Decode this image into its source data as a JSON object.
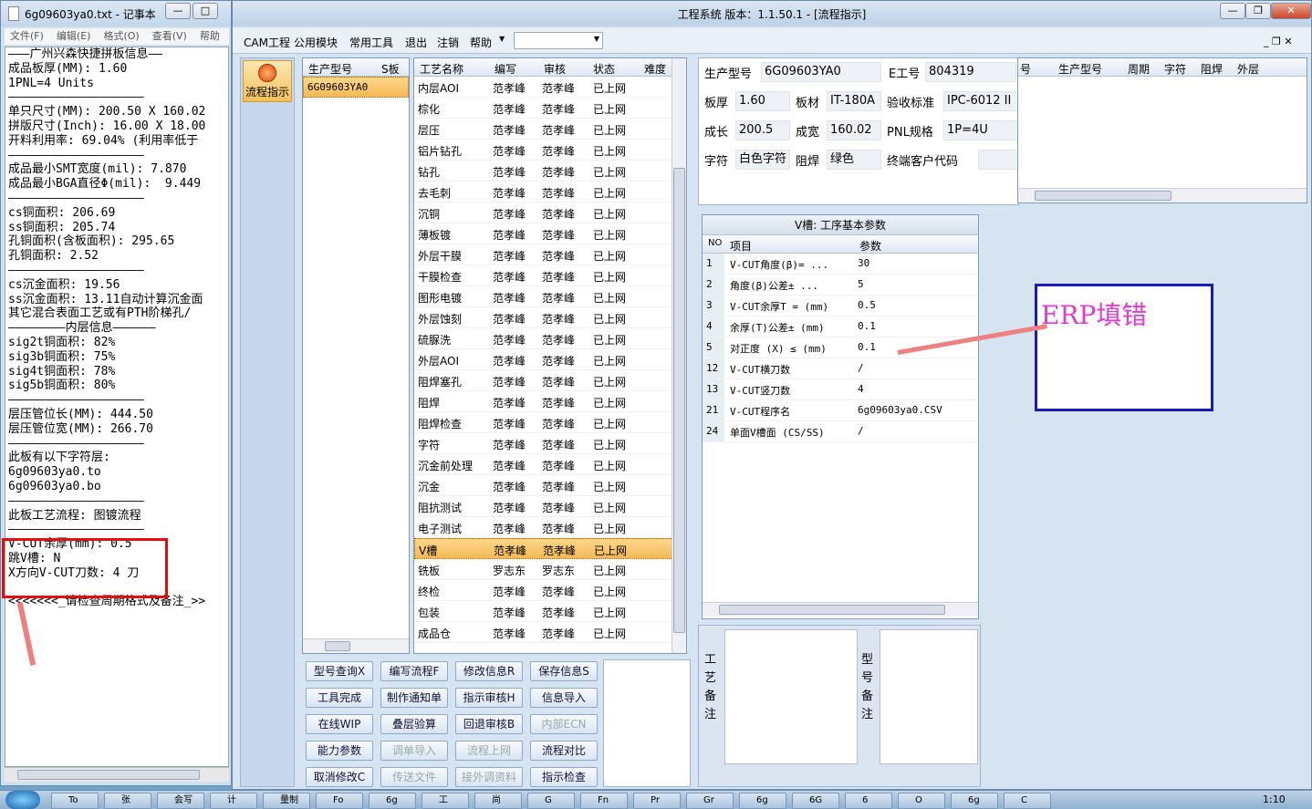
{
  "notepad": {
    "title": "6g09603ya0.txt - 记事本",
    "menu": [
      "文件(F)",
      "编辑(E)",
      "格式(O)",
      "查看(V)",
      "帮助"
    ],
    "lines": [
      "———广州兴森快捷拼板信息——",
      "成品板厚(MM): 1.60",
      "1PNL=4 Units",
      "———————————————————",
      "单只尺寸(MM): 200.50 X 160.02",
      "拼版尺寸(Inch): 16.00 X 18.00",
      "开料利用率: 69.04% (利用率低于",
      "———————————————————",
      "成品最小SMT宽度(mil): 7.870",
      "成品最小BGA直径Φ(mil):  9.449",
      "———————————————————",
      "cs铜面积: 206.69",
      "ss铜面积: 205.74",
      "孔铜面积(含板面积): 295.65",
      "孔铜面积: 2.52",
      "———————————————————",
      "cs沉金面积: 19.56",
      "ss沉金面积: 13.11自动计算沉金面",
      "其它混合表面工艺或有PTH阶梯孔/",
      "————————内层信息——————",
      "sig2t铜面积: 82%",
      "sig3b铜面积: 75%",
      "sig4t铜面积: 78%",
      "sig5b铜面积: 80%",
      "———————————————————",
      "层压管位长(MM): 444.50",
      "层压管位宽(MM): 266.70",
      "———————————————————",
      "此板有以下字符层:",
      "6g09603ya0.to",
      "6g09603ya0.bo",
      "———————————————————",
      "此板工艺流程: 图镀流程",
      "———————————————————",
      "V-CUT余厚(mm): 0.5",
      "跳V槽: N",
      "X方向V-CUT刀数: 4 刀",
      "",
      "<<<<<<<_请检查周期格式及备注_>>"
    ]
  },
  "app": {
    "title": "工程系统   版本：1.1.50.1 - [流程指示]",
    "menu": [
      "CAM工程",
      "公用模块",
      "常用工具",
      "退出",
      "注销",
      "帮助"
    ],
    "nav_button": "流程指示",
    "model_grid": {
      "headers": [
        "生产型号",
        "S板"
      ],
      "rows": [
        "6G09603YA0"
      ]
    },
    "process_grid": {
      "headers": [
        "工艺名称",
        "编写",
        "审核",
        "状态",
        "难度"
      ],
      "rows": [
        [
          "内层AOI",
          "范孝峰",
          "范孝峰",
          "已上网"
        ],
        [
          "棕化",
          "范孝峰",
          "范孝峰",
          "已上网"
        ],
        [
          "层压",
          "范孝峰",
          "范孝峰",
          "已上网"
        ],
        [
          "铝片钻孔",
          "范孝峰",
          "范孝峰",
          "已上网"
        ],
        [
          "钻孔",
          "范孝峰",
          "范孝峰",
          "已上网"
        ],
        [
          "去毛刺",
          "范孝峰",
          "范孝峰",
          "已上网"
        ],
        [
          "沉铜",
          "范孝峰",
          "范孝峰",
          "已上网"
        ],
        [
          "薄板镀",
          "范孝峰",
          "范孝峰",
          "已上网"
        ],
        [
          "外层干膜",
          "范孝峰",
          "范孝峰",
          "已上网"
        ],
        [
          "干膜检查",
          "范孝峰",
          "范孝峰",
          "已上网"
        ],
        [
          "图形电镀",
          "范孝峰",
          "范孝峰",
          "已上网"
        ],
        [
          "外层蚀刻",
          "范孝峰",
          "范孝峰",
          "已上网"
        ],
        [
          "硫脲洗",
          "范孝峰",
          "范孝峰",
          "已上网"
        ],
        [
          "外层AOI",
          "范孝峰",
          "范孝峰",
          "已上网"
        ],
        [
          "阻焊塞孔",
          "范孝峰",
          "范孝峰",
          "已上网"
        ],
        [
          "阻焊",
          "范孝峰",
          "范孝峰",
          "已上网"
        ],
        [
          "阻焊检查",
          "范孝峰",
          "范孝峰",
          "已上网"
        ],
        [
          "字符",
          "范孝峰",
          "范孝峰",
          "已上网"
        ],
        [
          "沉金前处理",
          "范孝峰",
          "范孝峰",
          "已上网"
        ],
        [
          "沉金",
          "范孝峰",
          "范孝峰",
          "已上网"
        ],
        [
          "阻抗测试",
          "范孝峰",
          "范孝峰",
          "已上网"
        ],
        [
          "电子测试",
          "范孝峰",
          "范孝峰",
          "已上网"
        ],
        [
          "V槽",
          "范孝峰",
          "范孝峰",
          "已上网"
        ],
        [
          "铣板",
          "罗志东",
          "罗志东",
          "已上网"
        ],
        [
          "终检",
          "范孝峰",
          "范孝峰",
          "已上网"
        ],
        [
          "包装",
          "范孝峰",
          "范孝峰",
          "已上网"
        ],
        [
          "成品仓",
          "范孝峰",
          "范孝峰",
          "已上网"
        ]
      ],
      "selected_index": 22
    },
    "info": {
      "model_label": "生产型号",
      "model": "6G09603YA0",
      "eno_label": "E工号",
      "eno": "804319",
      "thick_label": "板厚",
      "thick": "1.60",
      "mat_label": "板材",
      "mat": "IT-180A",
      "std_label": "验收标准",
      "std": "IPC-6012 II",
      "len_label": "成长",
      "len": "200.5",
      "wid_label": "成宽",
      "wid": "160.02",
      "pnl_label": "PNL规格",
      "pnl": "1P=4U",
      "char_label": "字符",
      "char": "白色字符",
      "mask_label": "阻焊",
      "mask": "绿色",
      "cust_label": "终端客户代码",
      "cust": ""
    },
    "right_grid_headers": [
      "号",
      "生产型号",
      "周期",
      "字符",
      "阻焊",
      "外层"
    ],
    "vcut": {
      "title": "V槽: 工序基本参数",
      "headers": [
        "NO",
        "项目",
        "参数"
      ],
      "rows": [
        [
          "1",
          "V-CUT角度(β)=  ...",
          "30"
        ],
        [
          "2",
          "角度(β)公差±   ...",
          "5"
        ],
        [
          "3",
          "V-CUT余厚T =  (mm)",
          "0.5"
        ],
        [
          "4",
          "余厚(T)公差±  (mm)",
          "0.1"
        ],
        [
          "5",
          "对正度 (X) ≤ (mm)",
          "0.1"
        ],
        [
          "12",
          "V-CUT横刀数",
          "/"
        ],
        [
          "13",
          "V-CUT竖刀数",
          "4"
        ],
        [
          "21",
          "V-CUT程序名",
          "6g09603ya0.CSV"
        ],
        [
          "24",
          "单面V槽面 (CS/SS)",
          "/"
        ]
      ]
    },
    "note_labels": {
      "process_note": "工艺备注",
      "model_note": "型号备注"
    },
    "buttons": [
      [
        "型号查询X",
        "编写流程F",
        "修改信息R",
        "保存信息S"
      ],
      [
        "工具完成",
        "制作通知单",
        "指示审核H",
        "信息导入"
      ],
      [
        "在线WIP",
        "叠层验算",
        "回退审核B",
        "内部ECN"
      ],
      [
        "能力参数",
        "调单导入",
        "流程上网",
        "流程对比"
      ],
      [
        "取消修改C",
        "传送文件",
        "接外调资料",
        "指示检查"
      ]
    ],
    "disabled_buttons": [
      "内部ECN",
      "调单导入",
      "流程上网",
      "传送文件",
      "接外调资料"
    ]
  },
  "annotation": {
    "text": "ERP填错"
  },
  "taskbar": {
    "items": [
      "To",
      "张",
      "会写",
      "计",
      "量制",
      "Fo",
      "6g",
      "工",
      "尚",
      "G",
      "Fn",
      "Pr",
      "Gr",
      "6g",
      "6G",
      "6",
      "O",
      "6g",
      "C"
    ],
    "clock": "1:10"
  },
  "colors": {
    "highlight": "#f6b955",
    "annotation_red": "#e01010",
    "annotation_blue": "#1a1ab8",
    "annotation_text": "#e03ad0"
  }
}
